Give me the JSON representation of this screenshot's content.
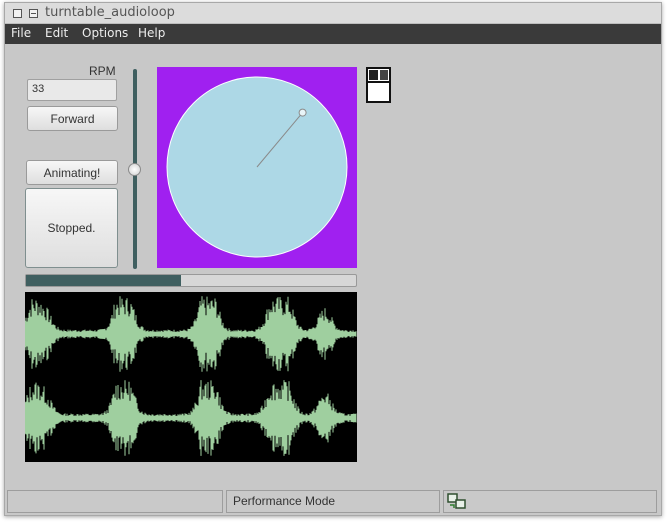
{
  "window": {
    "title": "turntable_audioloop"
  },
  "menu": {
    "items": [
      "File",
      "Edit",
      "Options",
      "Help"
    ]
  },
  "controls": {
    "rpm_label": "RPM",
    "rpm_value": "33",
    "direction_button": "Forward",
    "animating_button": "Animating!",
    "stopped_button": "Stopped."
  },
  "turntable": {
    "background_color": "#a020f0",
    "platter_color": "#add8e6",
    "needle_angle_deg": 40
  },
  "playback": {
    "progress": 0.47,
    "speed_slider": 0.5
  },
  "waveform": {
    "background_color": "#000000",
    "wave_color": "#9fcf9f",
    "channels": 2
  },
  "status": {
    "left": "",
    "mode": "Performance Mode",
    "icon": "network-status-icon"
  }
}
